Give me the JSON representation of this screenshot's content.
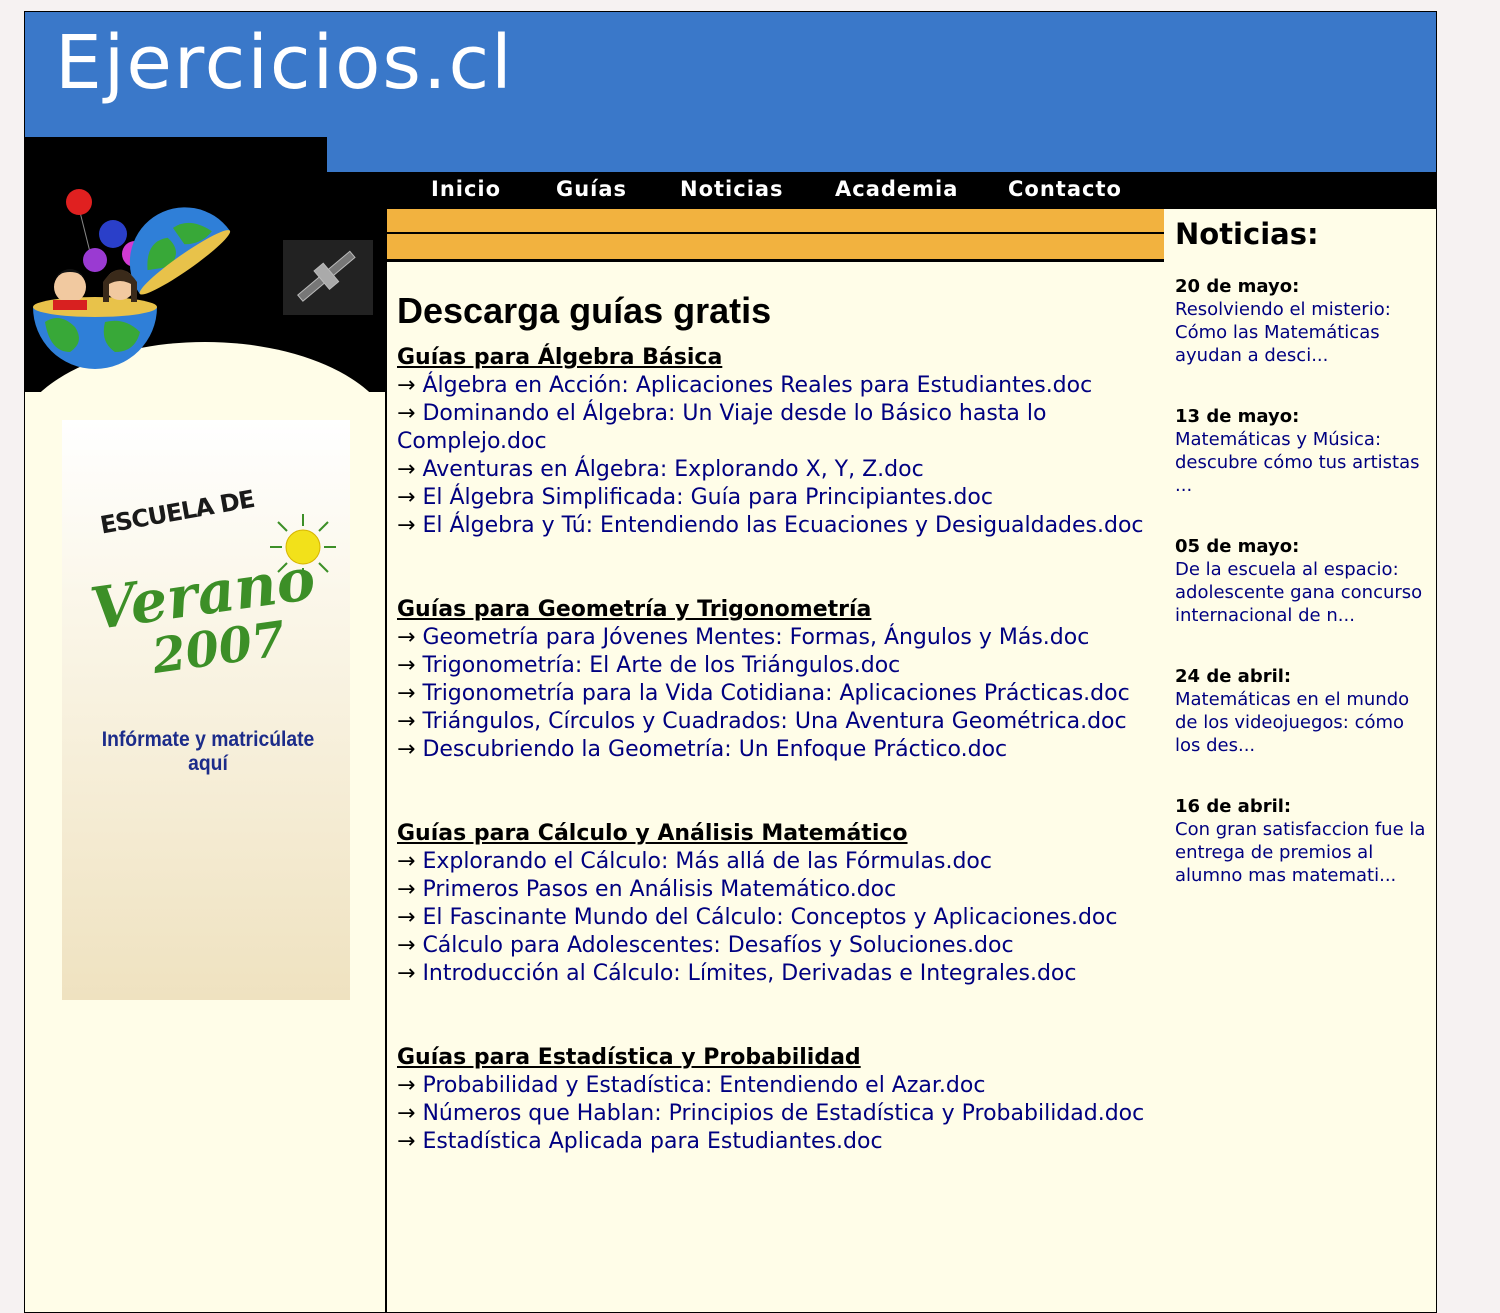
{
  "site": {
    "logo": "Ejercicios.cl"
  },
  "nav": [
    {
      "label": "Inicio"
    },
    {
      "label": "Guías"
    },
    {
      "label": "Noticias"
    },
    {
      "label": "Academia"
    },
    {
      "label": "Contacto"
    }
  ],
  "promo": {
    "line1": "ESCUELA DE",
    "line2": "Verano",
    "line3": "2007",
    "cta": "Infórmate y matricúlate aquí"
  },
  "main": {
    "title": "Descarga guías gratis",
    "arrow": "→",
    "sections": [
      {
        "title": "Guías para Álgebra Básica",
        "links": [
          "Álgebra en Acción: Aplicaciones Reales para Estudiantes.doc",
          "Dominando el Álgebra: Un Viaje desde lo Básico hasta lo Complejo.doc",
          "Aventuras en Álgebra: Explorando X, Y, Z.doc",
          "El Álgebra Simplificada: Guía para Principiantes.doc",
          "El Álgebra y Tú: Entendiendo las Ecuaciones y Desigualdades.doc"
        ]
      },
      {
        "title": "Guías para Geometría y Trigonometría",
        "links": [
          "Geometría para Jóvenes Mentes: Formas, Ángulos y Más.doc",
          "Trigonometría: El Arte de los Triángulos.doc",
          "Trigonometría para la Vida Cotidiana: Aplicaciones Prácticas.doc",
          "Triángulos, Círculos y Cuadrados: Una Aventura Geométrica.doc",
          "Descubriendo la Geometría: Un Enfoque Práctico.doc"
        ]
      },
      {
        "title": "Guías para Cálculo y Análisis Matemático",
        "links": [
          "Explorando el Cálculo: Más allá de las Fórmulas.doc",
          "Primeros Pasos en Análisis Matemático.doc",
          "El Fascinante Mundo del Cálculo: Conceptos y Aplicaciones.doc",
          "Cálculo para Adolescentes: Desafíos y Soluciones.doc",
          "Introducción al Cálculo: Límites, Derivadas e Integrales.doc"
        ]
      },
      {
        "title": "Guías para Estadística y Probabilidad",
        "links": [
          "Probabilidad y Estadística: Entendiendo el Azar.doc",
          "Números que Hablan: Principios de Estadística y Probabilidad.doc",
          "Estadística Aplicada para Estudiantes.doc"
        ]
      }
    ]
  },
  "news": {
    "title": "Noticias:",
    "items": [
      {
        "date": "20 de mayo:",
        "text": "Resolviendo el misterio: Cómo las Matemáticas ayudan a desci..."
      },
      {
        "date": "13 de mayo:",
        "text": "Matemáticas y Música: descubre cómo tus artistas ..."
      },
      {
        "date": "05 de mayo:",
        "text": "De la escuela al espacio: adolescente gana concurso internacional de n..."
      },
      {
        "date": "24 de abril:",
        "text": "Matemáticas en el mundo de los videojuegos: cómo los des..."
      },
      {
        "date": "16 de abril:",
        "text": "Con gran satisfaccion fue la entrega de premios al alumno mas matemati..."
      }
    ]
  },
  "colors": {
    "header_blue": "#3a78c9",
    "accent_yellow": "#f2b23f",
    "link_navy": "#000080",
    "background_cream": "#fffde8"
  }
}
